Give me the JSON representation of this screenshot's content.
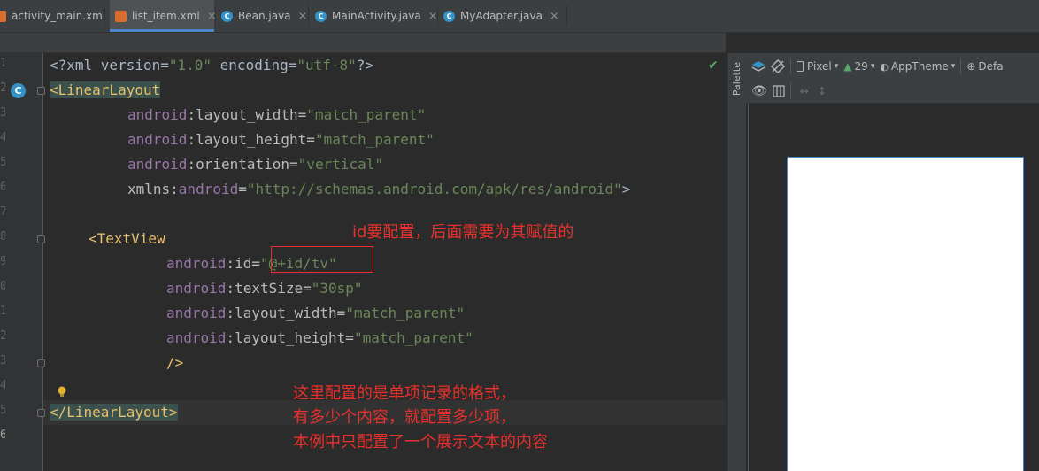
{
  "tabs": [
    {
      "label": "activity_main.xml",
      "icon": "xml-file-icon",
      "active": false
    },
    {
      "label": "list_item.xml",
      "icon": "xml-file-icon",
      "active": true
    },
    {
      "label": "Bean.java",
      "icon": "class-icon",
      "icon_letter": "C",
      "active": false
    },
    {
      "label": "MainActivity.java",
      "icon": "class-icon",
      "icon_letter": "C",
      "active": false
    },
    {
      "label": "MyAdapter.java",
      "icon": "class-icon",
      "icon_letter": "C",
      "active": false
    }
  ],
  "tab_close_glyph": "×",
  "gutter": {
    "line_numbers": [
      "1",
      "2",
      "3",
      "4",
      "5",
      "6",
      "7",
      "8",
      "9",
      "0",
      "1",
      "2",
      "3",
      "4",
      "5",
      "6"
    ],
    "class_marker": "C"
  },
  "code": {
    "l1_a": "<?xml version=",
    "l1_b": "\"1.0\"",
    "l1_c": " encoding=",
    "l1_d": "\"utf-8\"",
    "l1_e": "?>",
    "l2": "<LinearLayout",
    "l3_ns": "android",
    "l3_attr": ":layout_width=",
    "l3_val": "\"match_parent\"",
    "l4_ns": "android",
    "l4_attr": ":layout_height=",
    "l4_val": "\"match_parent\"",
    "l5_ns": "android",
    "l5_attr": ":orientation=",
    "l5_val": "\"vertical\"",
    "l6_attr": "xmlns:",
    "l6_ns": "android",
    "l6_eq": "=",
    "l6_val": "\"http://schemas.android.com/apk/res/android\"",
    "l6_end": ">",
    "l8": "<TextView",
    "l9_ns": "android",
    "l9_attr": ":id=",
    "l9_val": "\"@+id/tv\"",
    "l10_ns": "android",
    "l10_attr": ":textSize=",
    "l10_val": "\"30sp\"",
    "l11_ns": "android",
    "l11_attr": ":layout_width=",
    "l11_val": "\"match_parent\"",
    "l12_ns": "android",
    "l12_attr": ":layout_height=",
    "l12_val": "\"match_parent\"",
    "l13": "/>",
    "l15": "</LinearLayout>"
  },
  "annotations": {
    "id_note": "id要配置，后面需要为其赋值的",
    "format_note_1": "这里配置的是单项记录的格式，",
    "format_note_2": "有多少个内容，就配置多少项，",
    "format_note_3": "本例中只配置了一个展示文本的内容"
  },
  "design_panel": {
    "palette_label": "Palette",
    "device": "Pixel",
    "api_level": "29",
    "theme": "AppTheme",
    "locale": "Defa"
  },
  "colors": {
    "annotation_red": "#e8302c",
    "xml_tag": "#e8bf6a",
    "xml_value": "#6a8759",
    "xml_namespace": "#9876aa",
    "accent_blue": "#4a88c7"
  }
}
